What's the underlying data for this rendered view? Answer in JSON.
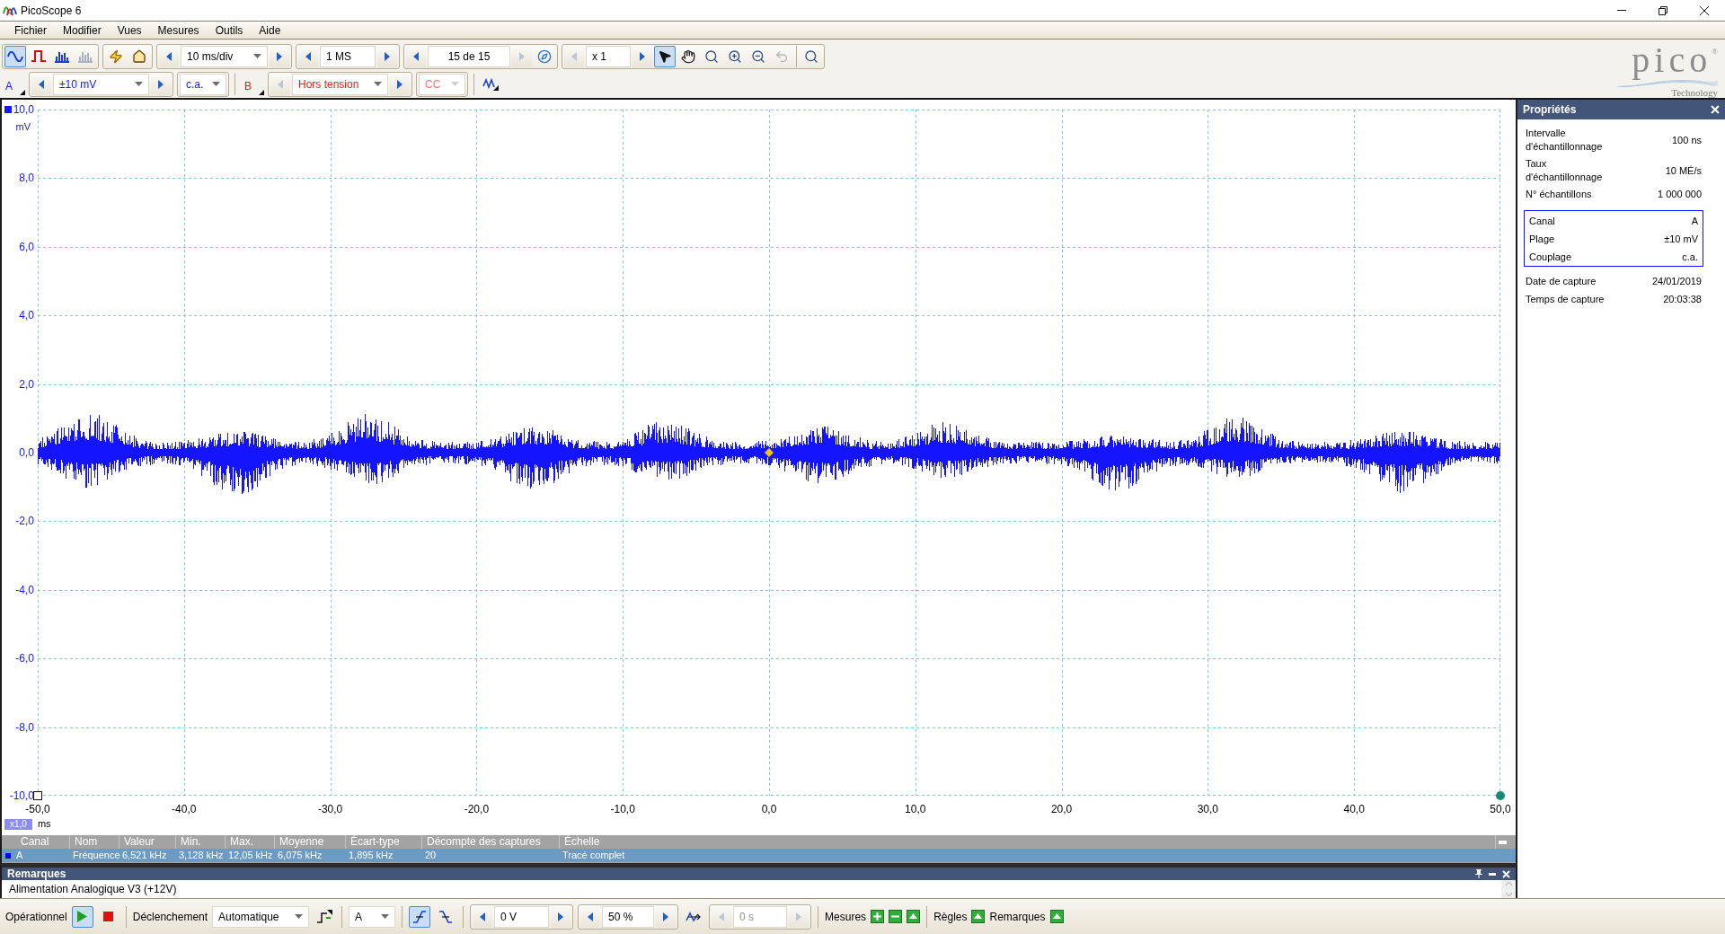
{
  "window": {
    "title": "PicoScope 6"
  },
  "menu": [
    {
      "label": "Fichier"
    },
    {
      "label": "Modifier"
    },
    {
      "label": "Vues"
    },
    {
      "label": "Mesures"
    },
    {
      "label": "Outils"
    },
    {
      "label": "Aide"
    }
  ],
  "toolbar": {
    "view_modes": [
      {
        "kind": "scope",
        "selected": true,
        "disabled": false
      },
      {
        "kind": "persistence",
        "selected": false,
        "disabled": false
      },
      {
        "kind": "spectrum",
        "selected": false,
        "disabled": false
      },
      {
        "kind": "spectrum",
        "selected": false,
        "disabled": true
      }
    ],
    "timebase": "10 ms/div",
    "samples": "1 MS",
    "buffer": {
      "value": "15 de 15",
      "prev_disabled": false,
      "next_disabled": true
    },
    "zoom": {
      "value": "x 1",
      "prev_disabled": true,
      "next_disabled": false
    },
    "tools": [
      {
        "kind": "pointer",
        "selected": true
      },
      {
        "kind": "hand",
        "selected": false
      },
      {
        "kind": "magnifier",
        "selected": false
      },
      {
        "kind": "zoom_in",
        "selected": false
      },
      {
        "kind": "zoom_out",
        "selected": false
      }
    ],
    "undo": {
      "disabled": true
    }
  },
  "channels": [
    {
      "name": "A",
      "color": "#1414ff",
      "range": "±10 mV",
      "range_prev_disabled": false,
      "coupling": "c.a.",
      "coupling_disabled": false
    },
    {
      "name": "B",
      "color": "#ff1414",
      "range": "Hors tension",
      "range_prev_disabled": true,
      "coupling": "CC",
      "coupling_disabled": true
    }
  ],
  "logo": {
    "name": "pico$^{®}$",
    "tagline": "Technology"
  },
  "chart": {
    "y_unit": "mV",
    "y_labels": [
      "10,0",
      "8,0",
      "6,0",
      "4,0",
      "2,0",
      "0,0",
      "-2,0",
      "-4,0",
      "-6,0",
      "-8,0",
      "-10,0"
    ],
    "x_scale": "x1,0",
    "x_unit": "ms",
    "x_labels": [
      "-50,0",
      "-40,0",
      "-30,0",
      "-20,0",
      "-10,0",
      "0,0",
      "10,0",
      "20,0",
      "30,0",
      "40,0",
      "50,0"
    ]
  },
  "properties": {
    "title": "Propriétés",
    "rows": [
      {
        "label": "Intervalle d'échantillonnage",
        "value": "100 ns"
      },
      {
        "label": "Taux d'échantillonnage",
        "value": "10 MÉ/s"
      },
      {
        "label": "N° échantillons",
        "value": "1 000 000"
      }
    ],
    "channel_rows": [
      {
        "label": "Canal",
        "value": "A"
      },
      {
        "label": "Plage",
        "value": "±10 mV"
      },
      {
        "label": "Couplage",
        "value": "c.a."
      }
    ],
    "capture_rows": [
      {
        "label": "Date de capture",
        "value": "24/01/2019"
      },
      {
        "label": "Temps de capture",
        "value": "20:03:38"
      }
    ]
  },
  "measurements": {
    "columns": [
      "Canal",
      "Nom",
      "Valeur",
      "Min.",
      "Max.",
      "Moyenne",
      "Écart-type",
      "Décompte des captures",
      "Échelle"
    ],
    "rows": [
      {
        "selected": true,
        "color": "#0000ff",
        "cells": [
          "A",
          "Fréquence",
          "6,521 kHz",
          "3,128 kHz",
          "12,05 kHz",
          "6,075 kHz",
          "1,895 kHz",
          "20",
          "Tracé complet"
        ]
      }
    ]
  },
  "remarks": {
    "title": "Remarques",
    "text": "Alimentation Analogique V3 (+12V)"
  },
  "status_bar": {
    "run_label": "Opérationnel",
    "run_buttons": [
      {
        "kind": "play",
        "selected": true
      },
      {
        "kind": "stop",
        "selected": false
      }
    ],
    "trigger_label": "Déclenchement",
    "trigger_mode": "Automatique",
    "trigger_source": "A",
    "edges": [
      {
        "kind": "rising",
        "selected": true
      },
      {
        "kind": "falling",
        "selected": false
      }
    ],
    "threshold": "0 V",
    "pretrigger": "50 %",
    "delay": {
      "value": "0 s",
      "disabled": true
    },
    "measures_label": "Mesures",
    "rulers_label": "Règles",
    "notes_label": "Remarques"
  }
}
